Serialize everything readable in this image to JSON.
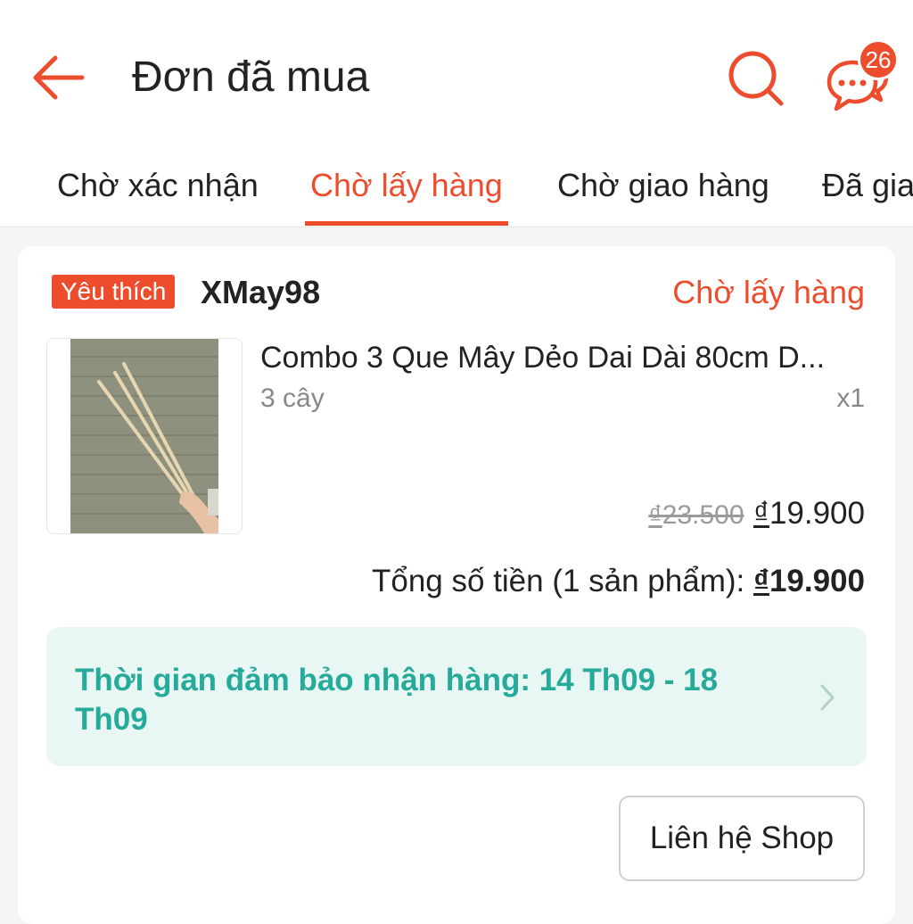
{
  "header": {
    "title": "Đơn đã mua",
    "chat_badge": "26",
    "icons": [
      "back-arrow-icon",
      "search-icon",
      "chat-icon"
    ],
    "accent_color": "#ee4d2d"
  },
  "tabs": [
    {
      "label": "Chờ xác nhận"
    },
    {
      "label": "Chờ lấy hàng",
      "active": true
    },
    {
      "label": "Chờ giao hàng"
    },
    {
      "label": "Đã gia"
    }
  ],
  "order": {
    "badge": "Yêu thích",
    "shop_name": "XMay98",
    "status": "Chờ lấy hàng",
    "product": {
      "name": "Combo 3 Que Mây Dẻo Dai Dài 80cm D...",
      "variant": "3 cây",
      "quantity": "x1",
      "currency": "₫",
      "original_price": "23.500",
      "price": "19.900"
    },
    "total_label": "Tổng số tiền (1 sản phẩm): ",
    "total_currency": "₫",
    "total_value": "19.900",
    "guarantee_text": "Thời gian đảm bảo nhận hàng: 14 Th09 - 18 Th09",
    "guarantee_color": "#26aa99",
    "contact_button": "Liên hệ Shop"
  }
}
